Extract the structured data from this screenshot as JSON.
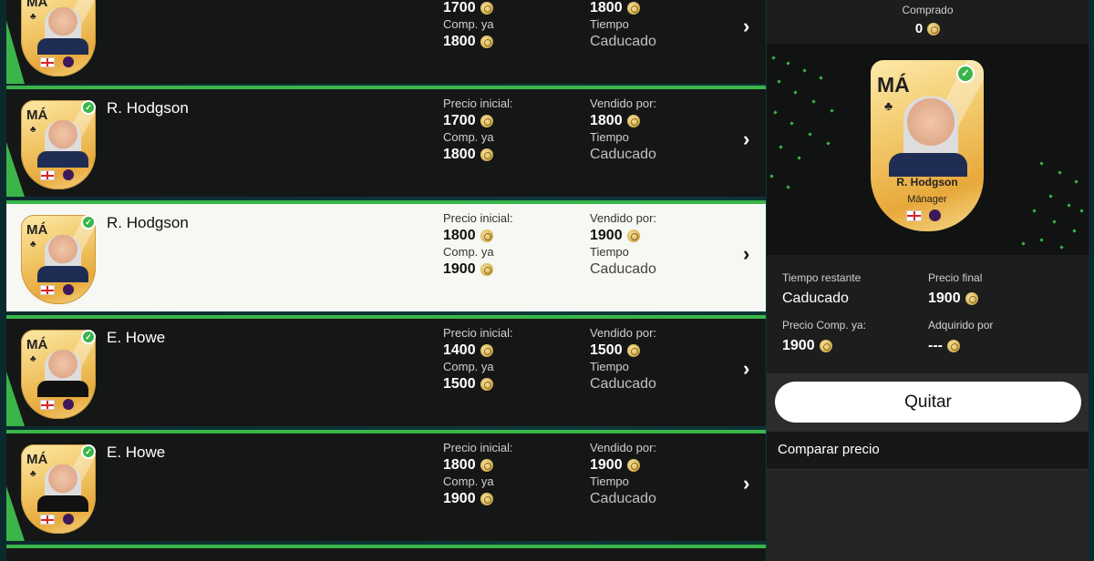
{
  "labels": {
    "start_price": "Precio inicial:",
    "sold_for": "Vendido por:",
    "buy_now": "Comp. ya",
    "time": "Tiempo",
    "expired": "Caducado"
  },
  "rows": [
    {
      "name": "",
      "position": "MÁ",
      "start_price": "1700",
      "sold_for": "1800",
      "buy_now": "1800",
      "status": "Caducado"
    },
    {
      "name": "R. Hodgson",
      "position": "MÁ",
      "start_price": "1700",
      "sold_for": "1800",
      "buy_now": "1800",
      "status": "Caducado"
    },
    {
      "name": "R. Hodgson",
      "position": "MÁ",
      "start_price": "1800",
      "sold_for": "1900",
      "buy_now": "1900",
      "status": "Caducado",
      "selected": true
    },
    {
      "name": "E. Howe",
      "position": "MÁ",
      "start_price": "1400",
      "sold_for": "1500",
      "buy_now": "1500",
      "status": "Caducado"
    },
    {
      "name": "E. Howe",
      "position": "MÁ",
      "start_price": "1800",
      "sold_for": "1900",
      "buy_now": "1900",
      "status": "Caducado"
    }
  ],
  "panel": {
    "bought_label": "Comprado",
    "bought_value": "0",
    "card": {
      "position": "MÁ",
      "name": "R. Hodgson",
      "role": "Mánager"
    },
    "time_left_label": "Tiempo restante",
    "time_left_value": "Caducado",
    "final_price_label": "Precio final",
    "final_price_value": "1900",
    "buy_now_label": "Precio Comp. ya:",
    "buy_now_value": "1900",
    "acquired_label": "Adquirido por",
    "acquired_value": "---",
    "remove_button": "Quitar",
    "compare_label": "Comparar precio"
  },
  "colors": {
    "accent": "#3bb54a",
    "row_bg": "#151716",
    "selected_bg": "#f7f7f3"
  },
  "icons": {
    "coin": "coin-icon",
    "check": "check-icon",
    "chevron": "chevron-right-icon",
    "flag": "england-flag-icon",
    "league": "premier-league-icon",
    "role": "club-icon"
  }
}
